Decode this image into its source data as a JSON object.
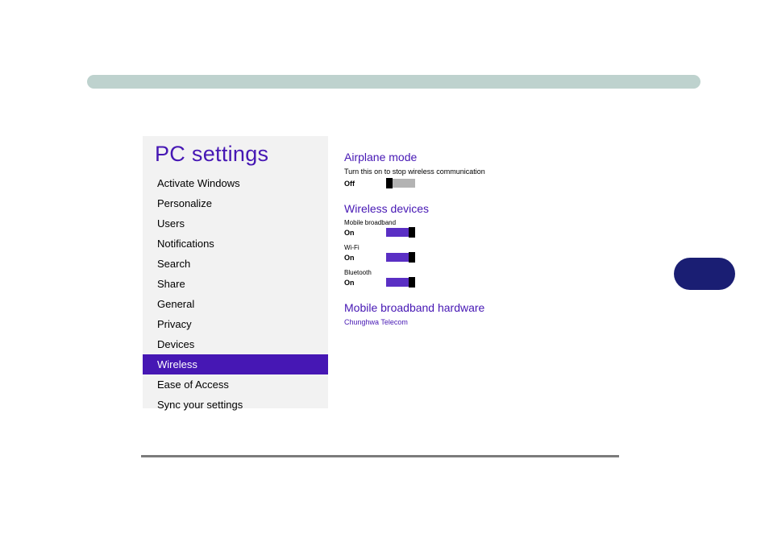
{
  "sidebar": {
    "title": "PC settings",
    "items": [
      {
        "label": "Activate Windows",
        "selected": false
      },
      {
        "label": "Personalize",
        "selected": false
      },
      {
        "label": "Users",
        "selected": false
      },
      {
        "label": "Notifications",
        "selected": false
      },
      {
        "label": "Search",
        "selected": false
      },
      {
        "label": "Share",
        "selected": false
      },
      {
        "label": "General",
        "selected": false
      },
      {
        "label": "Privacy",
        "selected": false
      },
      {
        "label": "Devices",
        "selected": false
      },
      {
        "label": "Wireless",
        "selected": true
      },
      {
        "label": "Ease of Access",
        "selected": false
      },
      {
        "label": "Sync your settings",
        "selected": false
      }
    ]
  },
  "airplane": {
    "title": "Airplane mode",
    "desc": "Turn this on to stop wireless communication",
    "state": "Off"
  },
  "wireless_devices": {
    "title": "Wireless devices",
    "items": [
      {
        "label": "Mobile broadband",
        "state": "On"
      },
      {
        "label": "Wi-Fi",
        "state": "On"
      },
      {
        "label": "Bluetooth",
        "state": "On"
      }
    ]
  },
  "mobile_hw": {
    "title": "Mobile broadband hardware",
    "link": "Chunghwa Telecom"
  }
}
